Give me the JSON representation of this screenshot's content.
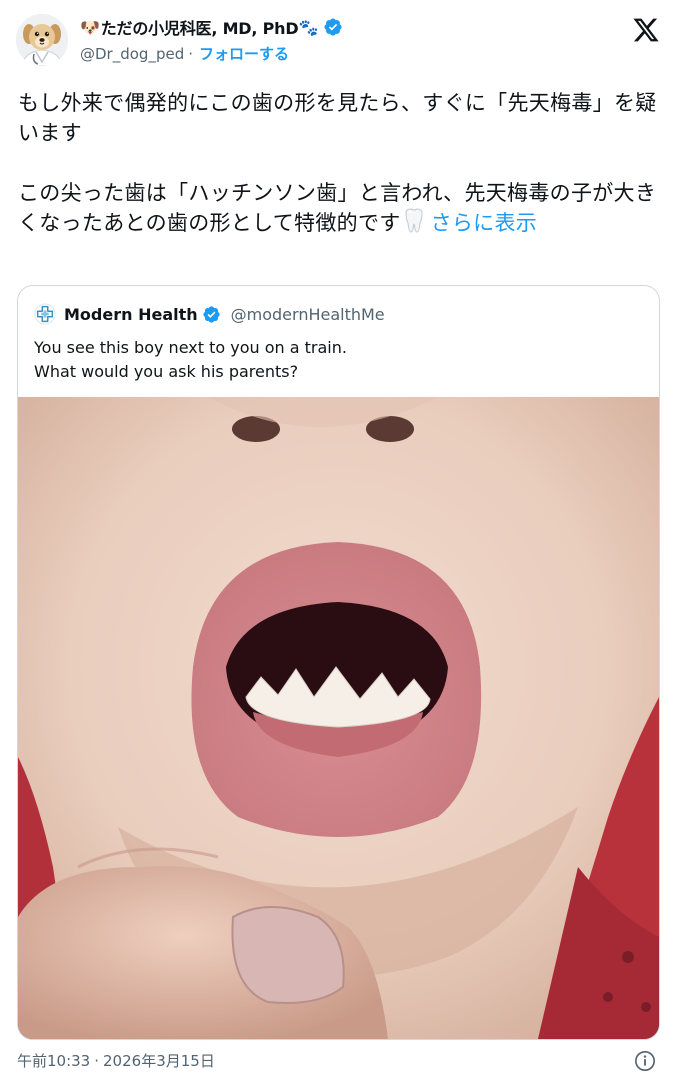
{
  "author": {
    "emoji_prefix": "🐶",
    "display_name": "ただの小児科医, MD, PhD",
    "emoji_suffix": "🐾",
    "handle": "@Dr_dog_ped",
    "separator": "·",
    "follow_label": "フォローする",
    "avatar_icon": "dog-avatar",
    "verified_color": "#1d9bf0"
  },
  "tweet": {
    "paragraph1": "もし外来で偶発的にこの歯の形を見たら、すぐに「先天梅毒」を疑います",
    "paragraph2": "この尖った歯は「ハッチンソン歯」と言われ、先天梅毒の子が大きくなったあとの歯の形として特徴的です",
    "emoji_icon": "tooth-emoji",
    "show_more_label": "さらに表示"
  },
  "quoted": {
    "name": "Modern Health",
    "handle": "@modernHealthMe",
    "lines": [
      "You see this boy next to you on a train.",
      "What would you ask his parents?"
    ],
    "photo_icon": "child-open-mouth-photo"
  },
  "footer": {
    "time": "午前10:33",
    "separator": "·",
    "date": "2026年3月15日",
    "info_icon": "info-icon"
  },
  "colors": {
    "accent": "#1d9bf0",
    "text": "#0f1419",
    "secondary": "#536471",
    "border": "#cfd9de"
  }
}
